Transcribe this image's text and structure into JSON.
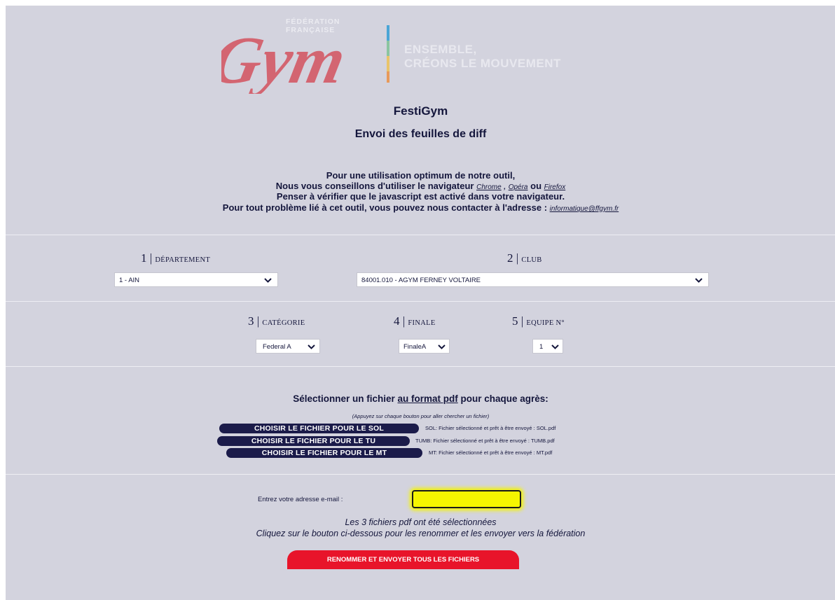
{
  "brand": {
    "logo_word": "Gym",
    "logo_sub_line1": "FÉDÉRATION",
    "logo_sub_line2": "FRANÇAISE",
    "slogan_line1": "ENSEMBLE,",
    "slogan_line2": "CRÉONS LE MOUVEMENT",
    "colors": {
      "logo_red": "#d94a5a",
      "bar_blue": "#4aa5d6",
      "bar_green": "#8bc5a0",
      "bar_yellow": "#e9c46a",
      "bar_orange": "#e89a5a"
    }
  },
  "header": {
    "title": "FestiGym",
    "subtitle": "Envoi des feuilles de diff"
  },
  "info": {
    "line1": "Pour une utilisation optimum de notre outil,",
    "line2_prefix": "Nous vous conseillons d'utiliser le navigateur",
    "browser_chrome": "Chrome",
    "sep_comma": ",",
    "browser_opera": "Opéra",
    "sep_ou": "ou",
    "browser_firefox": "Firefox",
    "line3": "Penser à vérifier que le javascript est activé dans votre navigateur.",
    "line4_prefix": "Pour tout problème lié à cet outil, vous pouvez nous contacter à l'adresse :",
    "email_link": "informatique@ffgym.fr"
  },
  "steps": {
    "s1": {
      "num": "1",
      "sep": "|",
      "label": "DÉPARTEMENT",
      "value": "1 - AIN"
    },
    "s2": {
      "num": "2",
      "sep": "|",
      "label": "CLUB",
      "value": "84001.010 - AGYM FERNEY VOLTAIRE"
    },
    "s3": {
      "num": "3",
      "sep": "|",
      "label": "CATÉGORIE",
      "value": "Federal A"
    },
    "s4": {
      "num": "4",
      "sep": "|",
      "label": "FINALE",
      "value": "FinaleA"
    },
    "s5": {
      "num": "5",
      "sep": "|",
      "label": "EQUIPE N°",
      "value": "1"
    }
  },
  "files": {
    "heading_prefix": "Sélectionner un fichier",
    "heading_underlined": "au format pdf",
    "heading_suffix": "pour chaque agrès:",
    "note": "(Appuyez sur chaque bouton pour aller chercher un fichier)",
    "items": [
      {
        "button": "CHOISIR LE FICHIER POUR LE SOL",
        "status": "SOL: Fichier sélectionné et prêt à être envoyé : SOL.pdf"
      },
      {
        "button": "CHOISIR LE FICHIER POUR LE TU",
        "status": "TUMB: Fichier sélectionné et prêt à être envoyé : TUMB.pdf"
      },
      {
        "button": "CHOISIR LE FICHIER POUR LE MT",
        "status": "MT: Fichier sélectionné et prêt à être envoyé : MT.pdf"
      }
    ]
  },
  "submit": {
    "email_label": "Entrez votre adresse e-mail :",
    "email_value": "",
    "msg_line1": "Les 3 fichiers pdf ont été sélectionnées",
    "msg_line2": "Cliquez sur le bouton ci-dessous pour les renommer et les envoyer vers la fédération",
    "send_button": "RENOMMER ET ENVOYER TOUS LES FICHIERS"
  }
}
